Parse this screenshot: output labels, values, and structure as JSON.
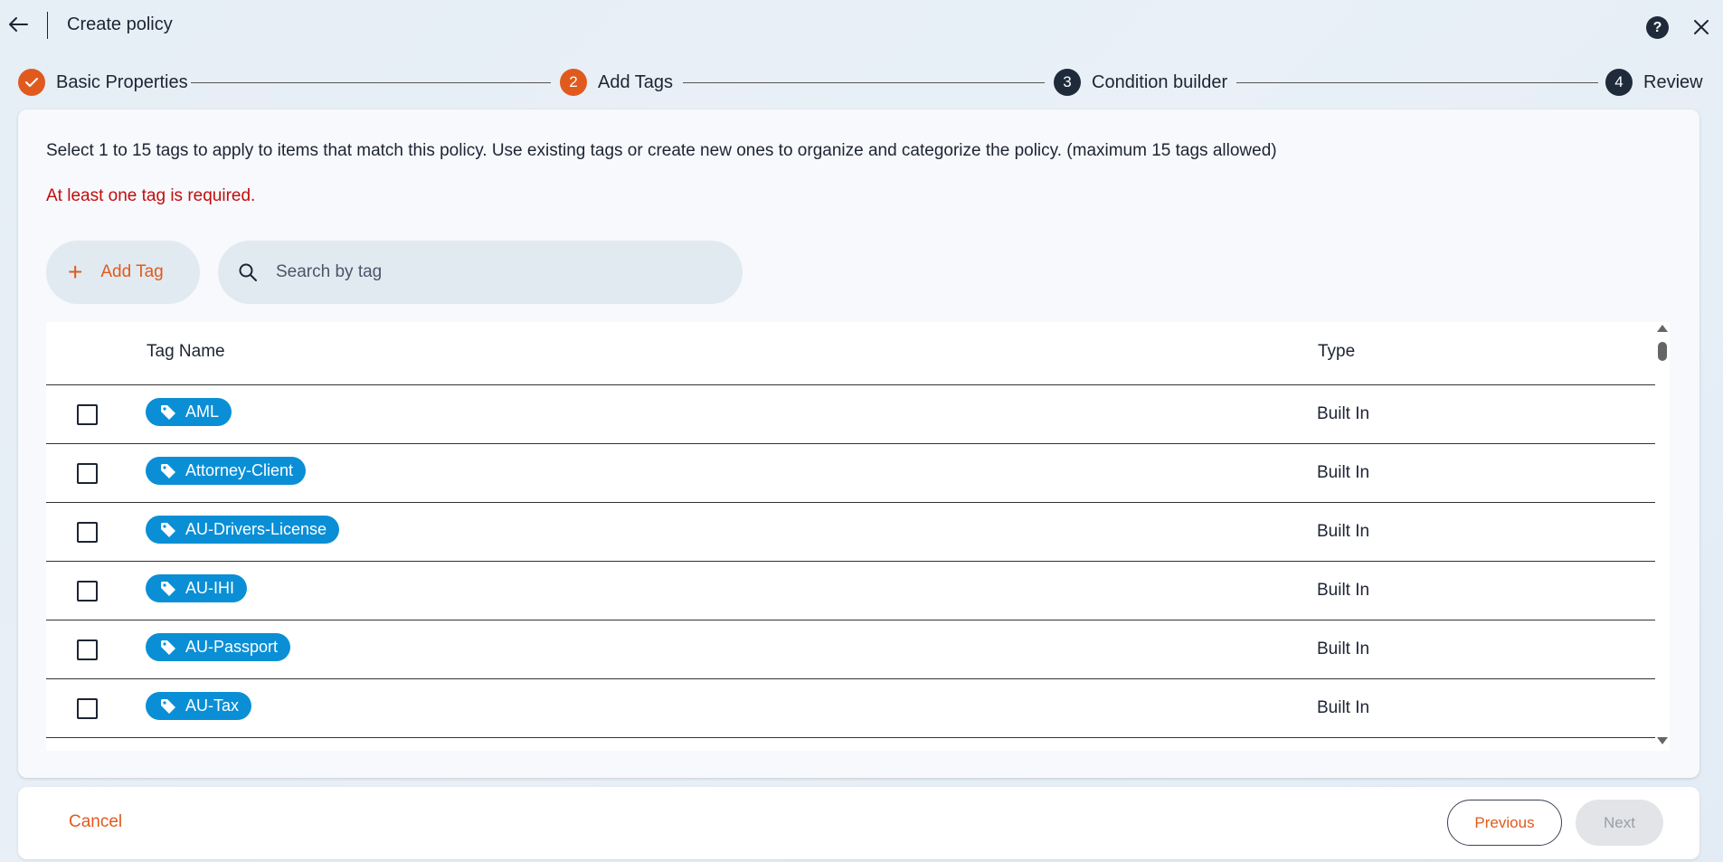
{
  "header": {
    "title": "Create policy",
    "help_label": "?"
  },
  "stepper": {
    "steps": [
      {
        "number": "",
        "label": "Basic Properties",
        "status": "completed"
      },
      {
        "number": "2",
        "label": "Add Tags",
        "status": "active"
      },
      {
        "number": "3",
        "label": "Condition builder",
        "status": "upcoming"
      },
      {
        "number": "4",
        "label": "Review",
        "status": "upcoming"
      }
    ]
  },
  "main": {
    "instructions": "Select 1 to 15 tags to apply to items that match this policy. Use existing tags or create new ones to organize and categorize the policy. (maximum 15 tags allowed)",
    "error": "At least one tag is required.",
    "add_tag_label": "Add Tag",
    "search_placeholder": "Search by tag"
  },
  "table": {
    "columns": [
      "Tag Name",
      "Type"
    ],
    "rows": [
      {
        "tag": "AML",
        "type": "Built In",
        "checked": false
      },
      {
        "tag": "Attorney-Client",
        "type": "Built In",
        "checked": false
      },
      {
        "tag": "AU-Drivers-License",
        "type": "Built In",
        "checked": false
      },
      {
        "tag": "AU-IHI",
        "type": "Built In",
        "checked": false
      },
      {
        "tag": "AU-Passport",
        "type": "Built In",
        "checked": false
      },
      {
        "tag": "AU-Tax",
        "type": "Built In",
        "checked": false
      }
    ]
  },
  "footer": {
    "cancel_label": "Cancel",
    "previous_label": "Previous",
    "next_label": "Next"
  },
  "colors": {
    "accent": "#e05a1e",
    "tag_pill": "#0a8fd6",
    "error": "#c20d0d",
    "dark": "#1f2a3a"
  }
}
